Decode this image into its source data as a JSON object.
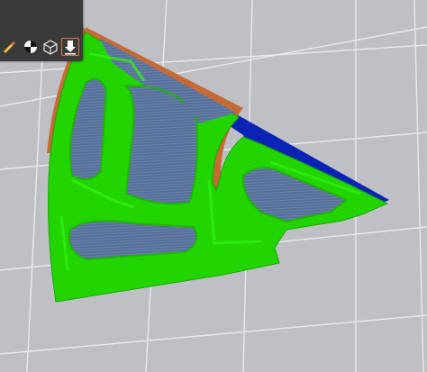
{
  "app": "slicer-3d-viewport",
  "toolbar": {
    "tools": [
      {
        "id": "paint",
        "icon": "paint-brush-icon",
        "active": false
      },
      {
        "id": "seam",
        "icon": "seam-painting-icon",
        "active": false
      },
      {
        "id": "cube",
        "icon": "wireframe-cube-icon",
        "active": false
      },
      {
        "id": "place",
        "icon": "place-on-face-icon",
        "active": true
      }
    ]
  },
  "colors": {
    "bed": "#bfc0c6",
    "grid": "#e9e9ef",
    "infill": "#56709a",
    "perimeter": "#22d800",
    "outer_perimeter": "#c66a35",
    "solid_infill": "#0a23b5",
    "toolbar_bg": "#3a3a3a",
    "active_outline": "#e07b39"
  }
}
